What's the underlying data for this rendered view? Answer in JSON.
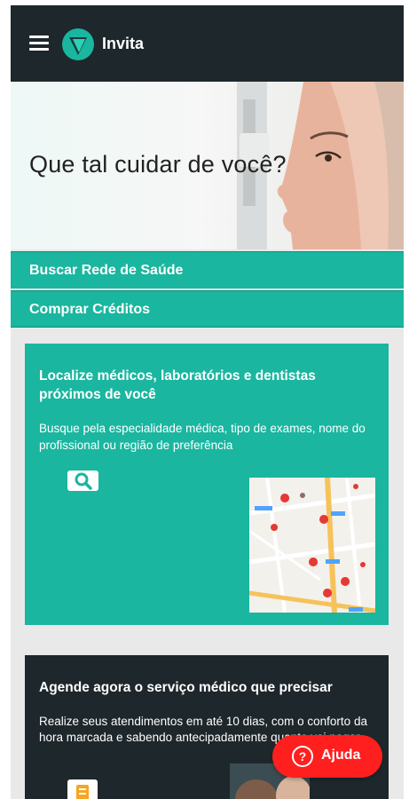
{
  "app": {
    "brand": "Invita"
  },
  "colors": {
    "appbar": "#1e272b",
    "accent": "#1ab69f",
    "help": "#ff1f1f"
  },
  "hero": {
    "headline": "Que tal cuidar de você?"
  },
  "menu": {
    "items": [
      {
        "label": "Buscar Rede de Saúde"
      },
      {
        "label": "Comprar Créditos"
      }
    ]
  },
  "card_locate": {
    "title": "Localize médicos, laboratórios e dentistas próximos de você",
    "description": "Busque pela especialidade médica, tipo de exames, nome do profissional ou região de preferência",
    "icons": [
      "search-icon",
      "map-icon"
    ]
  },
  "card_schedule": {
    "title": "Agende agora o serviço médico que precisar",
    "description": "Realize seus atendimentos em até 10 dias, com o conforto da hora marcada e sabendo antecipadamente quanto vai pagar."
  },
  "help": {
    "label": "Ajuda",
    "icon": "question-icon"
  }
}
